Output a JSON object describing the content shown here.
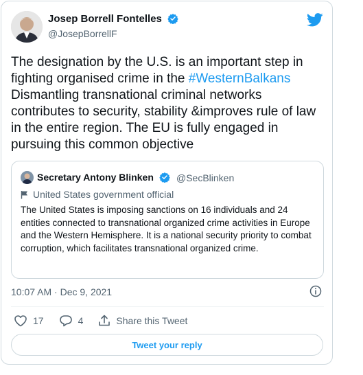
{
  "author": {
    "name": "Josep Borrell Fontelles",
    "handle": "@JosepBorrellF"
  },
  "tweet": {
    "text_before": "The designation by the U.S. is an important step in fighting organised crime in the ",
    "hashtag": "#WesternBalkans",
    "text_after": "\nDismantling transnational criminal networks contributes to security, stability &improves rule of law in the entire region. The EU is fully engaged in pursuing this common objective"
  },
  "quote": {
    "name": "Secretary Antony Blinken",
    "handle": "@SecBlinken",
    "label": "United States government official",
    "text": "The United States is imposing sanctions on 16 individuals and 24 entities connected to transnational organized crime activities in Europe and the Western Hemisphere. It is a national security priority to combat corruption, which facilitates transnational organized crime."
  },
  "meta": {
    "timestamp": "10:07 AM · Dec 9, 2021"
  },
  "actions": {
    "likes": "17",
    "replies": "4",
    "share_label": "Share this Tweet"
  },
  "reply_button": "Tweet your reply",
  "colors": {
    "accent": "#1d9bf0",
    "verified": "#1d9bf0",
    "like": "#536471"
  },
  "icons": [
    "verified-badge-icon",
    "twitter-bird-icon",
    "flag-icon",
    "info-icon",
    "heart-icon",
    "reply-bubble-icon",
    "share-icon"
  ]
}
